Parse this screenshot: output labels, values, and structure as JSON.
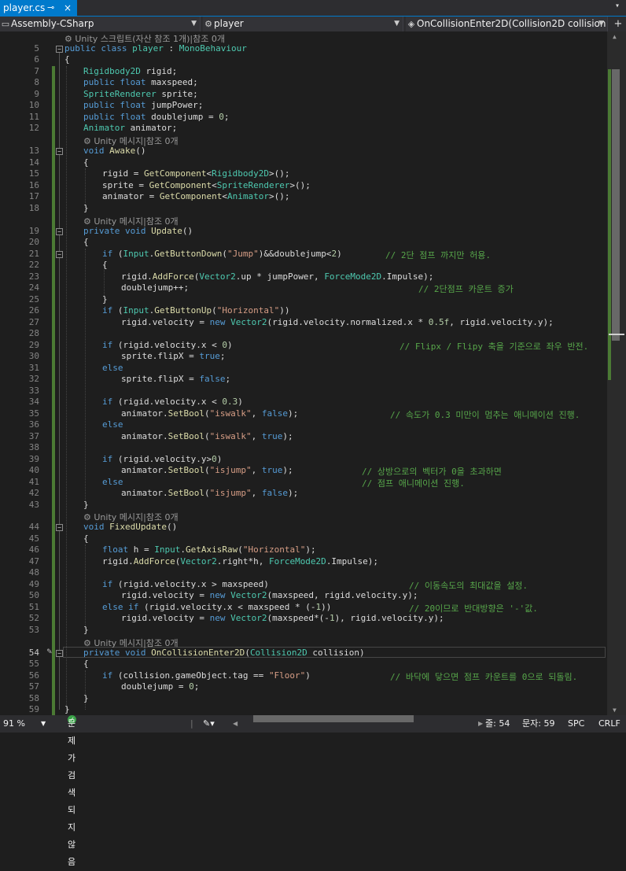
{
  "tab": {
    "filename": "player.cs",
    "pin": "⊸",
    "close": "×",
    "overflow": "▾"
  },
  "nav": {
    "project": "Assembly-CSharp",
    "class": "player",
    "member": "OnCollisionEnter2D(Collision2D collision",
    "split": "+"
  },
  "lens": {
    "l4": "Unity 스크립트(자산 참조 1개)|참조 0개",
    "l13": "Unity 메시지|참조 0개",
    "l19": "Unity 메시지|참조 0개",
    "l44": "Unity 메시지|참조 0개",
    "l54": "Unity 메시지|참조 0개"
  },
  "line_numbers": [
    "5",
    "6",
    "7",
    "8",
    "9",
    "10",
    "11",
    "12",
    "13",
    "14",
    "15",
    "16",
    "17",
    "18",
    "19",
    "20",
    "21",
    "22",
    "23",
    "24",
    "25",
    "26",
    "27",
    "28",
    "29",
    "30",
    "31",
    "32",
    "33",
    "34",
    "35",
    "36",
    "37",
    "38",
    "39",
    "40",
    "41",
    "42",
    "43",
    "44",
    "45",
    "46",
    "47",
    "48",
    "49",
    "50",
    "51",
    "52",
    "53",
    "54",
    "55",
    "56",
    "57",
    "58",
    "59"
  ],
  "code": {
    "l5": {
      "a": "public class ",
      "b": "player",
      "c": " : ",
      "d": "MonoBehaviour"
    },
    "l6": "{",
    "l7": {
      "a": "Rigidbody2D",
      "b": " rigid;"
    },
    "l8": {
      "a": "public float",
      "b": " maxspeed;"
    },
    "l9": {
      "a": "SpriteRenderer",
      "b": " sprite;"
    },
    "l10": {
      "a": "public float",
      "b": " jumpPower;"
    },
    "l11": {
      "a": "public float",
      "b": " doublejump = ",
      "c": "0",
      "d": ";"
    },
    "l12": {
      "a": "Animator",
      "b": " animator;"
    },
    "l13": {
      "a": "void ",
      "b": "Awake",
      "c": "()"
    },
    "l14": "{",
    "l15": {
      "a": "rigid = ",
      "b": "GetComponent",
      "c": "<",
      "d": "Rigidbody2D",
      "e": ">();"
    },
    "l16": {
      "a": "sprite = ",
      "b": "GetComponent",
      "c": "<",
      "d": "SpriteRenderer",
      "e": ">();"
    },
    "l17": {
      "a": "animator = ",
      "b": "GetComponent",
      "c": "<",
      "d": "Animator",
      "e": ">();"
    },
    "l18": "}",
    "l19": {
      "a": "private void ",
      "b": "Update",
      "c": "()"
    },
    "l20": "{",
    "l21": {
      "a": "if",
      "b": " (",
      "c": "Input",
      "d": ".",
      "e": "GetButtonDown",
      "f": "(",
      "g": "\"Jump\"",
      "h": ")&&doublejump<",
      "i": "2",
      "j": ")",
      "k": "// 2단 점프 까지만 허용."
    },
    "l22": "{",
    "l23": {
      "a": "rigid.",
      "b": "AddForce",
      "c": "(",
      "d": "Vector2",
      "e": ".up * jumpPower, ",
      "f": "ForceMode2D",
      "g": ".Impulse);"
    },
    "l24": {
      "a": "doublejump++;",
      "b": "// 2단점프 카운트 증가"
    },
    "l25": "}",
    "l26": {
      "a": "if",
      "b": " (",
      "c": "Input",
      "d": ".",
      "e": "GetButtonUp",
      "f": "(",
      "g": "\"Horizontal\"",
      "h": "))"
    },
    "l27": {
      "a": "rigid.velocity = ",
      "b": "new ",
      "c": "Vector2",
      "d": "(rigid.velocity.normalized.x * ",
      "e": "0.5f",
      "f": ", rigid.velocity.y);"
    },
    "l29": {
      "a": "if",
      "b": " (rigid.velocity.x < ",
      "c": "0",
      "d": ")",
      "e": "// Flipx / Flipy 축을 기준으로 좌우 반전."
    },
    "l30": {
      "a": "sprite.flipX = ",
      "b": "true",
      "c": ";"
    },
    "l31": {
      "a": "else"
    },
    "l32": {
      "a": "sprite.flipX = ",
      "b": "false",
      "c": ";"
    },
    "l34": {
      "a": "if",
      "b": " (rigid.velocity.x < ",
      "c": "0.3",
      "d": ")"
    },
    "l35": {
      "a": "animator.",
      "b": "SetBool",
      "c": "(",
      "d": "\"iswalk\"",
      "e": ", ",
      "f": "false",
      "g": ");",
      "h": "// 속도가 0.3 미만이 멈추는 애니메이션 진행."
    },
    "l36": {
      "a": "else"
    },
    "l37": {
      "a": "animator.",
      "b": "SetBool",
      "c": "(",
      "d": "\"iswalk\"",
      "e": ", ",
      "f": "true",
      "g": ");"
    },
    "l39": {
      "a": "if",
      "b": " (rigid.velocity.y>",
      "c": "0",
      "d": ")"
    },
    "l40": {
      "a": "animator.",
      "b": "SetBool",
      "c": "(",
      "d": "\"isjump\"",
      "e": ", ",
      "f": "true",
      "g": ");",
      "h": "// 상방으로의 벡터가 0을 초과하면"
    },
    "l41": {
      "a": "else",
      "b": "// 점프 애니메이션 진행."
    },
    "l42": {
      "a": "animator.",
      "b": "SetBool",
      "c": "(",
      "d": "\"isjump\"",
      "e": ", ",
      "f": "false",
      "g": ");"
    },
    "l43": "}",
    "l44": {
      "a": "void ",
      "b": "FixedUpdate",
      "c": "()"
    },
    "l45": "{",
    "l46": {
      "a": "float",
      "b": " h = ",
      "c": "Input",
      "d": ".",
      "e": "GetAxisRaw",
      "f": "(",
      "g": "\"Horizontal\"",
      "h": ");"
    },
    "l47": {
      "a": "rigid.",
      "b": "AddForce",
      "c": "(",
      "d": "Vector2",
      "e": ".right*h, ",
      "f": "ForceMode2D",
      "g": ".Impulse);"
    },
    "l49": {
      "a": "if",
      "b": " (rigid.velocity.x > maxspeed)",
      "c": "// 이동속도의 최대값을 설정."
    },
    "l50": {
      "a": "rigid.velocity = ",
      "b": "new ",
      "c": "Vector2",
      "d": "(maxspeed, rigid.velocity.y);"
    },
    "l51": {
      "a": "else if",
      "b": " (rigid.velocity.x < maxspeed * (-",
      "c": "1",
      "d": "))",
      "e": "// 20이므로 반대방향은 '-'값."
    },
    "l52": {
      "a": "rigid.velocity = ",
      "b": "new ",
      "c": "Vector2",
      "d": "(maxspeed*(-",
      "e": "1",
      "f": "), rigid.velocity.y);"
    },
    "l53": "}",
    "l54": {
      "a": "private void ",
      "b": "OnCollisionEnter2D",
      "c": "(",
      "d": "Collision2D",
      "e": " collision",
      "f": ")"
    },
    "l55": "{",
    "l56": {
      "a": "if",
      "b": " (collision.gameObject.tag == ",
      "c": "\"Floor\"",
      "d": ")",
      "e": "// 바닥에 닿으면 점프 카운트를 0으로 되돌림."
    },
    "l57": {
      "a": "doublejump = ",
      "b": "0",
      "c": ";"
    },
    "l58": "}",
    "l59": "}"
  },
  "status": {
    "zoom": "91 %",
    "issues": "문제가 검색되지 않음",
    "line": "줄: 54",
    "col": "문자: 59",
    "spc": "SPC",
    "crlf": "CRLF"
  },
  "colors": {
    "accent": "#007acc",
    "keyword": "#569cd6",
    "type": "#4ec9b0",
    "method": "#dcdcaa",
    "string": "#d69d85",
    "number": "#b5cea8",
    "comment": "#57a64a",
    "change_bar": "#4b7a34"
  }
}
